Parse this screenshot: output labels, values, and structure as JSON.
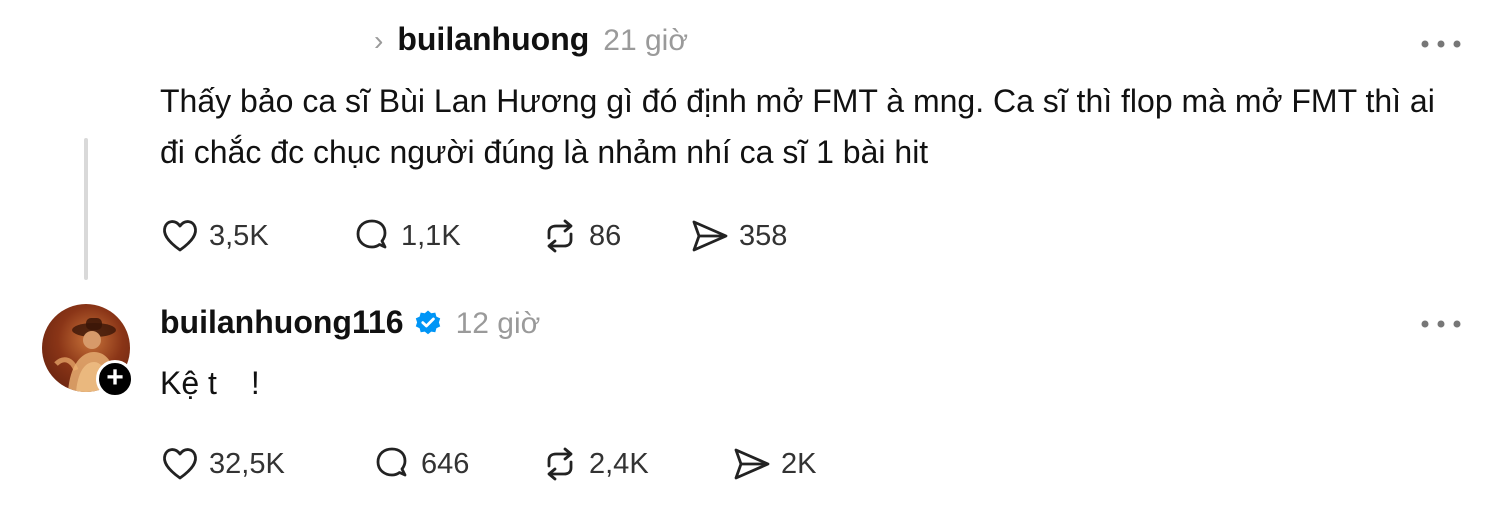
{
  "posts": [
    {
      "username": "builanhuong",
      "time": "21 giờ",
      "text": "Thấy bảo ca sĩ Bùi Lan Hương gì đó định mở FMT à mng. Ca sĩ thì flop mà mở FMT thì ai đi chắc đc chục người đúng là nhảm nhí ca sĩ 1 bài hit",
      "likes": "3,5K",
      "replies": "1,1K",
      "reposts": "86",
      "shares": "358"
    },
    {
      "username": "builanhuong116",
      "verified": true,
      "time": "12 giờ",
      "text_start": "Kệ t",
      "text_end": "!",
      "likes": "32,5K",
      "replies": "646",
      "reposts": "2,4K",
      "shares": "2K"
    }
  ],
  "icons": {
    "reply_indicator": "chevron-right-icon",
    "more": "more-horizontal-icon",
    "like": "heart-icon",
    "reply": "comment-bubble-icon",
    "repost": "repost-icon",
    "share": "send-icon",
    "verified": "verified-badge-icon",
    "follow": "plus-icon"
  },
  "colors": {
    "text": "#111111",
    "muted": "#9a9a9a",
    "verified": "#0095f6",
    "thread_line": "#d9d9d9"
  }
}
